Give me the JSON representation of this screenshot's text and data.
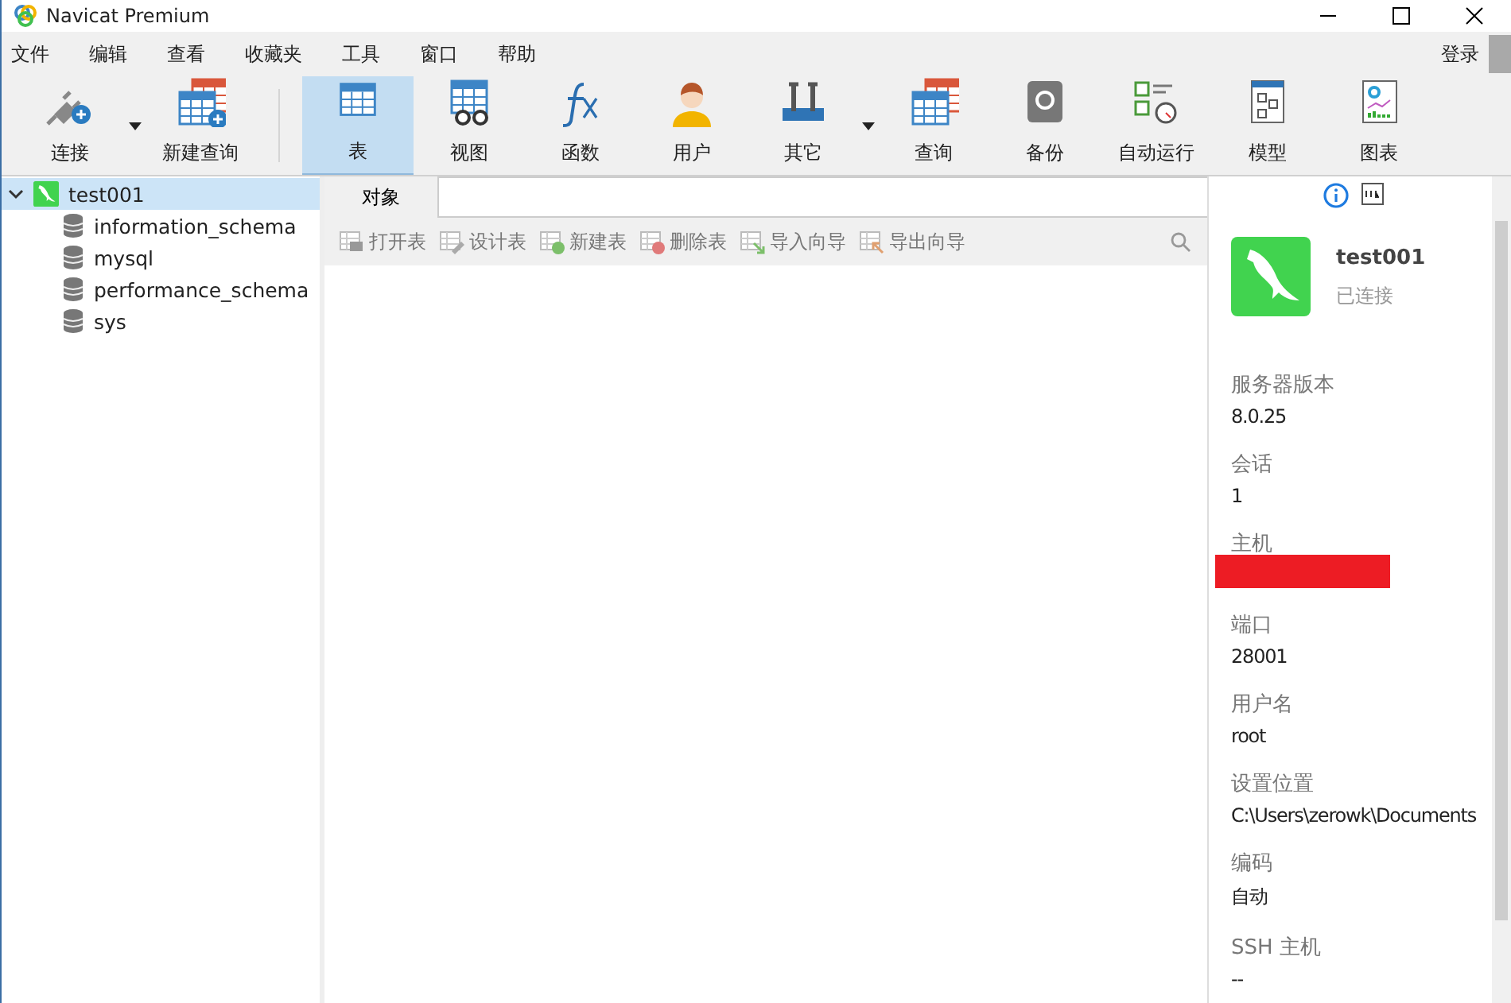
{
  "window": {
    "title": "Navicat Premium"
  },
  "menu": [
    "文件",
    "编辑",
    "查看",
    "收藏夹",
    "工具",
    "窗口",
    "帮助"
  ],
  "login": "登录",
  "toolbar": [
    {
      "label": "连接",
      "kind": "plug",
      "dropdown": true,
      "selected": false
    },
    {
      "label": "新建查询",
      "kind": "newquery",
      "dropdown": false,
      "selected": false
    },
    {
      "label": "表",
      "kind": "table",
      "dropdown": false,
      "selected": true,
      "group_start": true
    },
    {
      "label": "视图",
      "kind": "view",
      "dropdown": false,
      "selected": false
    },
    {
      "label": "函数",
      "kind": "function",
      "dropdown": false,
      "selected": false
    },
    {
      "label": "用户",
      "kind": "user",
      "dropdown": false,
      "selected": false
    },
    {
      "label": "其它",
      "kind": "tools",
      "dropdown": true,
      "selected": false
    },
    {
      "label": "查询",
      "kind": "query",
      "dropdown": false,
      "selected": false
    },
    {
      "label": "备份",
      "kind": "backup",
      "dropdown": false,
      "selected": false
    },
    {
      "label": "自动运行",
      "kind": "schedule",
      "dropdown": false,
      "selected": false
    },
    {
      "label": "模型",
      "kind": "model",
      "dropdown": false,
      "selected": false
    },
    {
      "label": "图表",
      "kind": "chart",
      "dropdown": false,
      "selected": false
    }
  ],
  "tree": [
    {
      "label": "test001",
      "expanded": true,
      "selected": true,
      "children": [
        {
          "label": "information_schema"
        },
        {
          "label": "mysql"
        },
        {
          "label": "performance_schema"
        },
        {
          "label": "sys"
        }
      ]
    }
  ],
  "tabs": [
    {
      "label": "对象",
      "selected": true
    }
  ],
  "object_actions": [
    {
      "label": "打开表",
      "kind": "open"
    },
    {
      "label": "设计表",
      "kind": "design"
    },
    {
      "label": "新建表",
      "kind": "new"
    },
    {
      "label": "删除表",
      "kind": "delete"
    },
    {
      "label": "导入向导",
      "kind": "import"
    },
    {
      "label": "导出向导",
      "kind": "export"
    }
  ],
  "info_panel": {
    "name": "test001",
    "status": "已连接",
    "fields": [
      {
        "label": "服务器版本",
        "value": "8.0.25"
      },
      {
        "label": "会话",
        "value": "1"
      },
      {
        "label": "主机",
        "redacted": true
      },
      {
        "label": "端口",
        "value": "28001"
      },
      {
        "label": "用户名",
        "value": "root"
      },
      {
        "label": "设置位置",
        "value": "C:\\Users\\zerowk\\Documents"
      },
      {
        "label": "编码",
        "value": "自动"
      },
      {
        "label": "SSH 主机",
        "value": "--"
      }
    ]
  }
}
